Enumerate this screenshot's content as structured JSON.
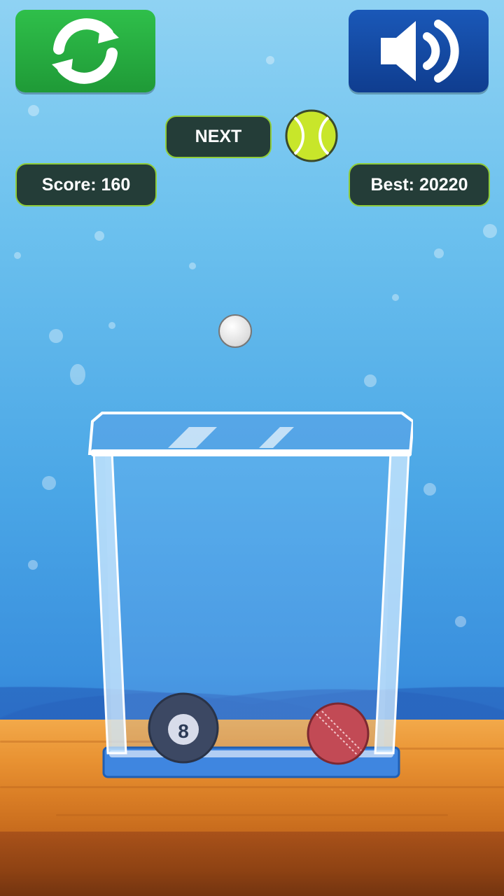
{
  "controls": {
    "restart_icon": "refresh-icon",
    "sound_icon": "speaker-icon"
  },
  "hud": {
    "next_label": "NEXT",
    "next_ball": "tennis-ball",
    "score_text": "Score: 160",
    "best_text": "Best: 20220"
  },
  "playfield": {
    "dropping_ball": "golf-ball",
    "container_balls": [
      {
        "type": "eight-ball",
        "label": "8"
      },
      {
        "type": "cricket-ball"
      }
    ]
  },
  "colors": {
    "restart_button": "#1f9a37",
    "sound_button": "#0f3d8f",
    "pill_bg": "#243d38",
    "pill_border": "#8fcc3a",
    "tennis_ball": "#c8e62a",
    "cricket_ball": "#c24a55"
  }
}
